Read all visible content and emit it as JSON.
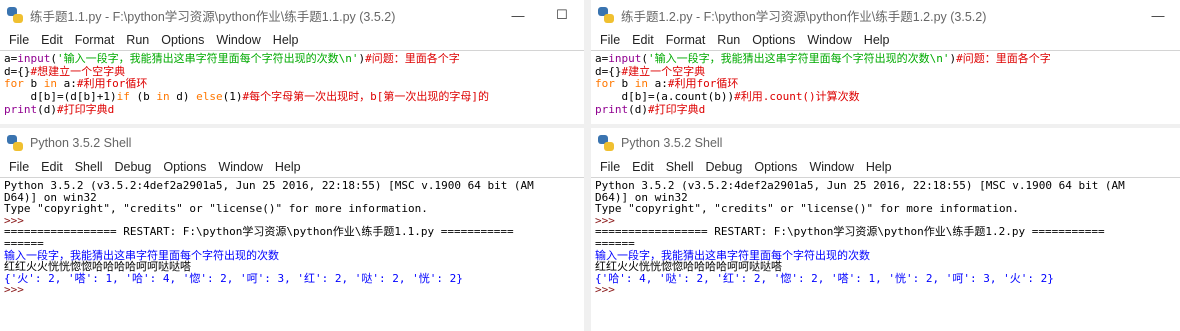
{
  "windows": {
    "editor_left": {
      "title": "练手题1.1.py - F:\\python学习资源\\python作业\\练手题1.1.py (3.5.2)",
      "menu": [
        "File",
        "Edit",
        "Format",
        "Run",
        "Options",
        "Window",
        "Help"
      ]
    },
    "editor_right": {
      "title": "练手题1.2.py - F:\\python学习资源\\python作业\\练手题1.2.py (3.5.2)",
      "menu": [
        "File",
        "Edit",
        "Format",
        "Run",
        "Options",
        "Window",
        "Help"
      ]
    },
    "shell_left": {
      "title": "Python 3.5.2 Shell",
      "menu": [
        "File",
        "Edit",
        "Shell",
        "Debug",
        "Options",
        "Window",
        "Help"
      ]
    },
    "shell_right": {
      "title": "Python 3.5.2 Shell",
      "menu": [
        "File",
        "Edit",
        "Shell",
        "Debug",
        "Options",
        "Window",
        "Help"
      ]
    }
  },
  "window_controls": {
    "minimize": "—",
    "maximize": "☐"
  },
  "code_left": {
    "l1_a": "a=",
    "l1_b": "input",
    "l1_c": "(",
    "l1_d": "'输入一段字，我能猜出这串字符里面每个字符出现的次数\\n'",
    "l1_e": ")",
    "l1_f": "#问题：里面各个字",
    "l2_a": "d={}",
    "l2_b": "#想建立一个空字典",
    "l3_a": "for",
    "l3_b": " b ",
    "l3_c": "in",
    "l3_d": " a:",
    "l3_e": "#利用for循环",
    "l4_a": "    d[b]=(d[b]+1)",
    "l4_b": "if",
    "l4_c": " (b ",
    "l4_d": "in",
    "l4_e": " d) ",
    "l4_f": "else",
    "l4_g": "(1)",
    "l4_h": "#每个字母第一次出现时，b[第一次出现的字母]的",
    "l5_a": "print",
    "l5_b": "(d)",
    "l5_c": "#打印字典d"
  },
  "code_right": {
    "l1_a": "a=",
    "l1_b": "input",
    "l1_c": "(",
    "l1_d": "'输入一段字，我能猜出这串字符里面每个字符出现的次数\\n'",
    "l1_e": ")",
    "l1_f": "#问题：里面各个字",
    "l2_a": "d={}",
    "l2_b": "#建立一个空字典",
    "l3_a": "for",
    "l3_b": " b ",
    "l3_c": "in",
    "l3_d": " a:",
    "l3_e": "#利用for循环",
    "l4_a": "    d[b]=(a.count(b))",
    "l4_b": "#利用.count()计算次数",
    "l5_a": "print",
    "l5_b": "(d)",
    "l5_c": "#打印字典d"
  },
  "shell_left_text": {
    "banner1": "Python 3.5.2 (v3.5.2:4def2a2901a5, Jun 25 2016, 22:18:55) [MSC v.1900 64 bit (AM",
    "banner2": "D64)] on win32",
    "banner3": "Type \"copyright\", \"credits\" or \"license()\" for more information.",
    "prompt1": ">>> ",
    "restart1": "================= RESTART: F:\\python学习资源\\python作业\\练手题1.1.py ===========",
    "restart2": "======",
    "out_prompt": "输入一段字，我能猜出这串字符里面每个字符出现的次数",
    "user_input": "红红火火恍恍惚惚哈哈哈哈呵呵哒哒嗒",
    "result": "{'火': 2, '嗒': 1, '哈': 4, '惚': 2, '呵': 3, '红': 2, '哒': 2, '恍': 2}",
    "prompt2": ">>> "
  },
  "shell_right_text": {
    "banner1": "Python 3.5.2 (v3.5.2:4def2a2901a5, Jun 25 2016, 22:18:55) [MSC v.1900 64 bit (AM",
    "banner2": "D64)] on win32",
    "banner3": "Type \"copyright\", \"credits\" or \"license()\" for more information.",
    "prompt1": ">>> ",
    "restart1": "================= RESTART: F:\\python学习资源\\python作业\\练手题1.2.py ===========",
    "restart2": "======",
    "out_prompt": "输入一段字，我能猜出这串字符里面每个字符出现的次数",
    "user_input": "红红火火恍恍惚惚哈哈哈哈呵呵哒哒嗒",
    "result": "{'哈': 4, '哒': 2, '红': 2, '惚': 2, '嗒': 1, '恍': 2, '呵': 3, '火': 2}",
    "prompt2": ">>> "
  },
  "colors": {
    "keyword": "#ff7700",
    "builtin": "#900090",
    "string": "#00aa00",
    "comment": "#dd0000",
    "shell_output": "#0000ff",
    "shell_prompt": "#8b1a1a"
  }
}
